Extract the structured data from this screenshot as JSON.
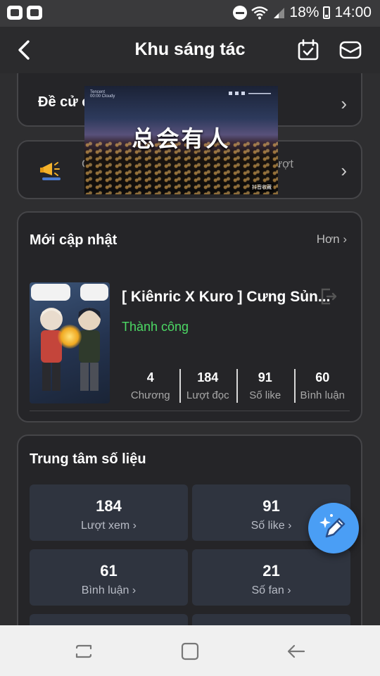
{
  "status_bar": {
    "battery": "18%",
    "time": "14:00"
  },
  "header": {
    "title": "Khu sáng tác"
  },
  "recommend_card": {
    "label": "Đề cử c"
  },
  "notice_card": {
    "left_fragment": "C",
    "right_fragment": "lượt"
  },
  "video_overlay": {
    "caption": "总会有人",
    "tag_line1": "Tencent",
    "tag_line2": "00:00 Cloudy",
    "badge": "抖音收藏"
  },
  "recent": {
    "title": "Mới cập nhật",
    "more_label": "Hơn",
    "story": {
      "title": "[ Kiênric X Kuro ] Cưng Sủn...",
      "status": "Thành công",
      "status_color": "#4cd964",
      "stats": [
        {
          "value": "4",
          "label": "Chương"
        },
        {
          "value": "184",
          "label": "Lượt đọc"
        },
        {
          "value": "91",
          "label": "Số like"
        },
        {
          "value": "60",
          "label": "Bình luận"
        }
      ]
    }
  },
  "data_center": {
    "title": "Trung tâm số liệu",
    "tiles": [
      {
        "value": "184",
        "label": "Lượt xem"
      },
      {
        "value": "91",
        "label": "Số like"
      },
      {
        "value": "61",
        "label": "Bình luận"
      },
      {
        "value": "21",
        "label": "Số fan"
      }
    ]
  },
  "colors": {
    "accent": "#4a9ef5",
    "card_bg": "#252528",
    "tile_bg": "#2f343f"
  },
  "icons": [
    "back-arrow-icon",
    "calendar-check-icon",
    "mail-icon",
    "megaphone-icon",
    "chevron-right-icon",
    "edit-pencil-icon",
    "exit-icon"
  ]
}
